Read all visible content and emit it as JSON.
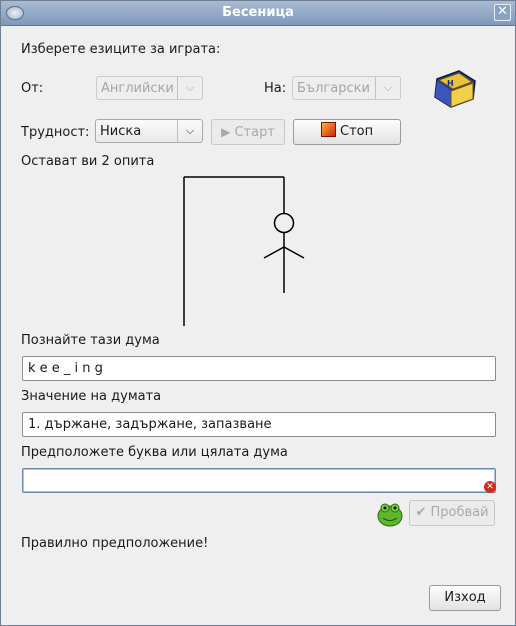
{
  "window": {
    "title": "Бесеница"
  },
  "languages": {
    "prompt": "Изберете езиците за играта:",
    "from_label": "От:",
    "from_value": "Английски",
    "to_label": "На:",
    "to_value": "Български"
  },
  "difficulty": {
    "label": "Трудност:",
    "value": "Ниска"
  },
  "buttons": {
    "start": "Старт",
    "stop": "Стоп",
    "try": "Пробвай",
    "exit": "Изход"
  },
  "status": {
    "attempts": "Остават ви 2 опита",
    "result": "Правилно предположение!"
  },
  "word": {
    "label": "Познайте тази дума",
    "value": "k e e _ i n g"
  },
  "meaning": {
    "label": "Значение на думата",
    "value": "1. държане, задържане, запазване"
  },
  "guess": {
    "label": "Предположете буква или цялата дума",
    "value": ""
  },
  "colors": {
    "titlebar": "#8fa7c6",
    "stop_icon": "#e43b1d",
    "focus": "#6b8ab8"
  }
}
